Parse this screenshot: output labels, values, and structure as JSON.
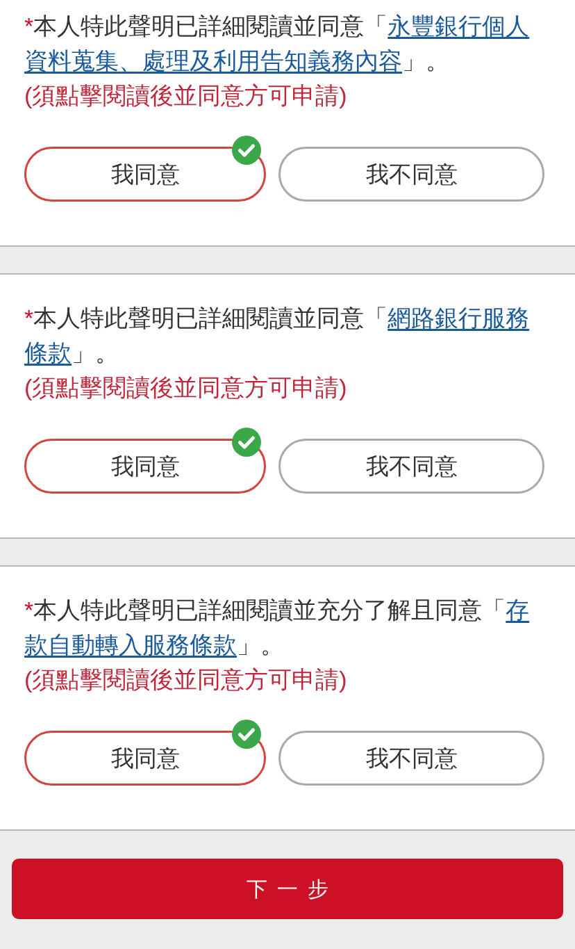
{
  "sections": [
    {
      "statement": {
        "required_mark": "*",
        "lead": "本人特此聲明已詳細閱讀並同意「",
        "link_lines": [
          "永豐銀行個人",
          "資料蒐集、處理及利用告知義務內容"
        ],
        "tail": "」。"
      },
      "note": "(須點擊閱讀後並同意方可申請)",
      "options": [
        {
          "label": "我同意",
          "selected": true
        },
        {
          "label": "我不同意",
          "selected": false
        }
      ]
    },
    {
      "statement": {
        "required_mark": "*",
        "lead": "本人特此聲明已詳細閱讀並同意「",
        "link_lines": [
          "網路銀行服務",
          "條款"
        ],
        "tail": "」。"
      },
      "note": "(須點擊閱讀後並同意方可申請)",
      "options": [
        {
          "label": "我同意",
          "selected": true
        },
        {
          "label": "我不同意",
          "selected": false
        }
      ]
    },
    {
      "statement": {
        "required_mark": "*",
        "lead": "本人特此聲明已詳細閱讀並充分了解且同意「",
        "link_lines": [
          "存",
          "款自動轉入服務條款"
        ],
        "tail": "」。"
      },
      "note": "(須點擊閱讀後並同意方可申請)",
      "options": [
        {
          "label": "我同意",
          "selected": true
        },
        {
          "label": "我不同意",
          "selected": false
        }
      ]
    }
  ],
  "next_button": {
    "label": "下一步"
  }
}
